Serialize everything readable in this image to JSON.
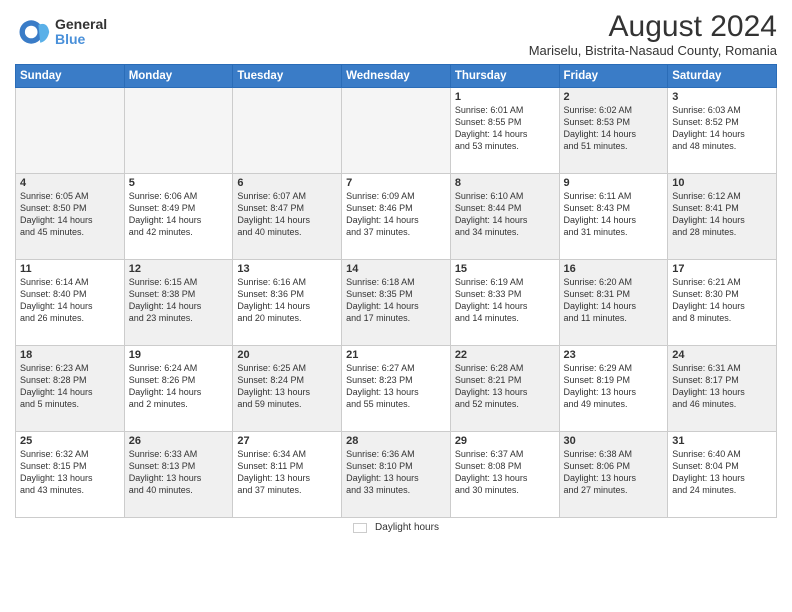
{
  "header": {
    "logo_general": "General",
    "logo_blue": "Blue",
    "title": "August 2024",
    "subtitle": "Mariselu, Bistrita-Nasaud County, Romania"
  },
  "calendar": {
    "headers": [
      "Sunday",
      "Monday",
      "Tuesday",
      "Wednesday",
      "Thursday",
      "Friday",
      "Saturday"
    ],
    "weeks": [
      [
        {
          "day": "",
          "info": "",
          "empty": true
        },
        {
          "day": "",
          "info": "",
          "empty": true
        },
        {
          "day": "",
          "info": "",
          "empty": true
        },
        {
          "day": "",
          "info": "",
          "empty": true
        },
        {
          "day": "1",
          "info": "Sunrise: 6:01 AM\nSunset: 8:55 PM\nDaylight: 14 hours\nand 53 minutes."
        },
        {
          "day": "2",
          "info": "Sunrise: 6:02 AM\nSunset: 8:53 PM\nDaylight: 14 hours\nand 51 minutes."
        },
        {
          "day": "3",
          "info": "Sunrise: 6:03 AM\nSunset: 8:52 PM\nDaylight: 14 hours\nand 48 minutes."
        }
      ],
      [
        {
          "day": "4",
          "info": "Sunrise: 6:05 AM\nSunset: 8:50 PM\nDaylight: 14 hours\nand 45 minutes."
        },
        {
          "day": "5",
          "info": "Sunrise: 6:06 AM\nSunset: 8:49 PM\nDaylight: 14 hours\nand 42 minutes."
        },
        {
          "day": "6",
          "info": "Sunrise: 6:07 AM\nSunset: 8:47 PM\nDaylight: 14 hours\nand 40 minutes."
        },
        {
          "day": "7",
          "info": "Sunrise: 6:09 AM\nSunset: 8:46 PM\nDaylight: 14 hours\nand 37 minutes."
        },
        {
          "day": "8",
          "info": "Sunrise: 6:10 AM\nSunset: 8:44 PM\nDaylight: 14 hours\nand 34 minutes."
        },
        {
          "day": "9",
          "info": "Sunrise: 6:11 AM\nSunset: 8:43 PM\nDaylight: 14 hours\nand 31 minutes."
        },
        {
          "day": "10",
          "info": "Sunrise: 6:12 AM\nSunset: 8:41 PM\nDaylight: 14 hours\nand 28 minutes."
        }
      ],
      [
        {
          "day": "11",
          "info": "Sunrise: 6:14 AM\nSunset: 8:40 PM\nDaylight: 14 hours\nand 26 minutes."
        },
        {
          "day": "12",
          "info": "Sunrise: 6:15 AM\nSunset: 8:38 PM\nDaylight: 14 hours\nand 23 minutes."
        },
        {
          "day": "13",
          "info": "Sunrise: 6:16 AM\nSunset: 8:36 PM\nDaylight: 14 hours\nand 20 minutes."
        },
        {
          "day": "14",
          "info": "Sunrise: 6:18 AM\nSunset: 8:35 PM\nDaylight: 14 hours\nand 17 minutes."
        },
        {
          "day": "15",
          "info": "Sunrise: 6:19 AM\nSunset: 8:33 PM\nDaylight: 14 hours\nand 14 minutes."
        },
        {
          "day": "16",
          "info": "Sunrise: 6:20 AM\nSunset: 8:31 PM\nDaylight: 14 hours\nand 11 minutes."
        },
        {
          "day": "17",
          "info": "Sunrise: 6:21 AM\nSunset: 8:30 PM\nDaylight: 14 hours\nand 8 minutes."
        }
      ],
      [
        {
          "day": "18",
          "info": "Sunrise: 6:23 AM\nSunset: 8:28 PM\nDaylight: 14 hours\nand 5 minutes."
        },
        {
          "day": "19",
          "info": "Sunrise: 6:24 AM\nSunset: 8:26 PM\nDaylight: 14 hours\nand 2 minutes."
        },
        {
          "day": "20",
          "info": "Sunrise: 6:25 AM\nSunset: 8:24 PM\nDaylight: 13 hours\nand 59 minutes."
        },
        {
          "day": "21",
          "info": "Sunrise: 6:27 AM\nSunset: 8:23 PM\nDaylight: 13 hours\nand 55 minutes."
        },
        {
          "day": "22",
          "info": "Sunrise: 6:28 AM\nSunset: 8:21 PM\nDaylight: 13 hours\nand 52 minutes."
        },
        {
          "day": "23",
          "info": "Sunrise: 6:29 AM\nSunset: 8:19 PM\nDaylight: 13 hours\nand 49 minutes."
        },
        {
          "day": "24",
          "info": "Sunrise: 6:31 AM\nSunset: 8:17 PM\nDaylight: 13 hours\nand 46 minutes."
        }
      ],
      [
        {
          "day": "25",
          "info": "Sunrise: 6:32 AM\nSunset: 8:15 PM\nDaylight: 13 hours\nand 43 minutes."
        },
        {
          "day": "26",
          "info": "Sunrise: 6:33 AM\nSunset: 8:13 PM\nDaylight: 13 hours\nand 40 minutes."
        },
        {
          "day": "27",
          "info": "Sunrise: 6:34 AM\nSunset: 8:11 PM\nDaylight: 13 hours\nand 37 minutes."
        },
        {
          "day": "28",
          "info": "Sunrise: 6:36 AM\nSunset: 8:10 PM\nDaylight: 13 hours\nand 33 minutes."
        },
        {
          "day": "29",
          "info": "Sunrise: 6:37 AM\nSunset: 8:08 PM\nDaylight: 13 hours\nand 30 minutes."
        },
        {
          "day": "30",
          "info": "Sunrise: 6:38 AM\nSunset: 8:06 PM\nDaylight: 13 hours\nand 27 minutes."
        },
        {
          "day": "31",
          "info": "Sunrise: 6:40 AM\nSunset: 8:04 PM\nDaylight: 13 hours\nand 24 minutes."
        }
      ]
    ]
  },
  "footer": {
    "legend_label": "Daylight hours"
  }
}
